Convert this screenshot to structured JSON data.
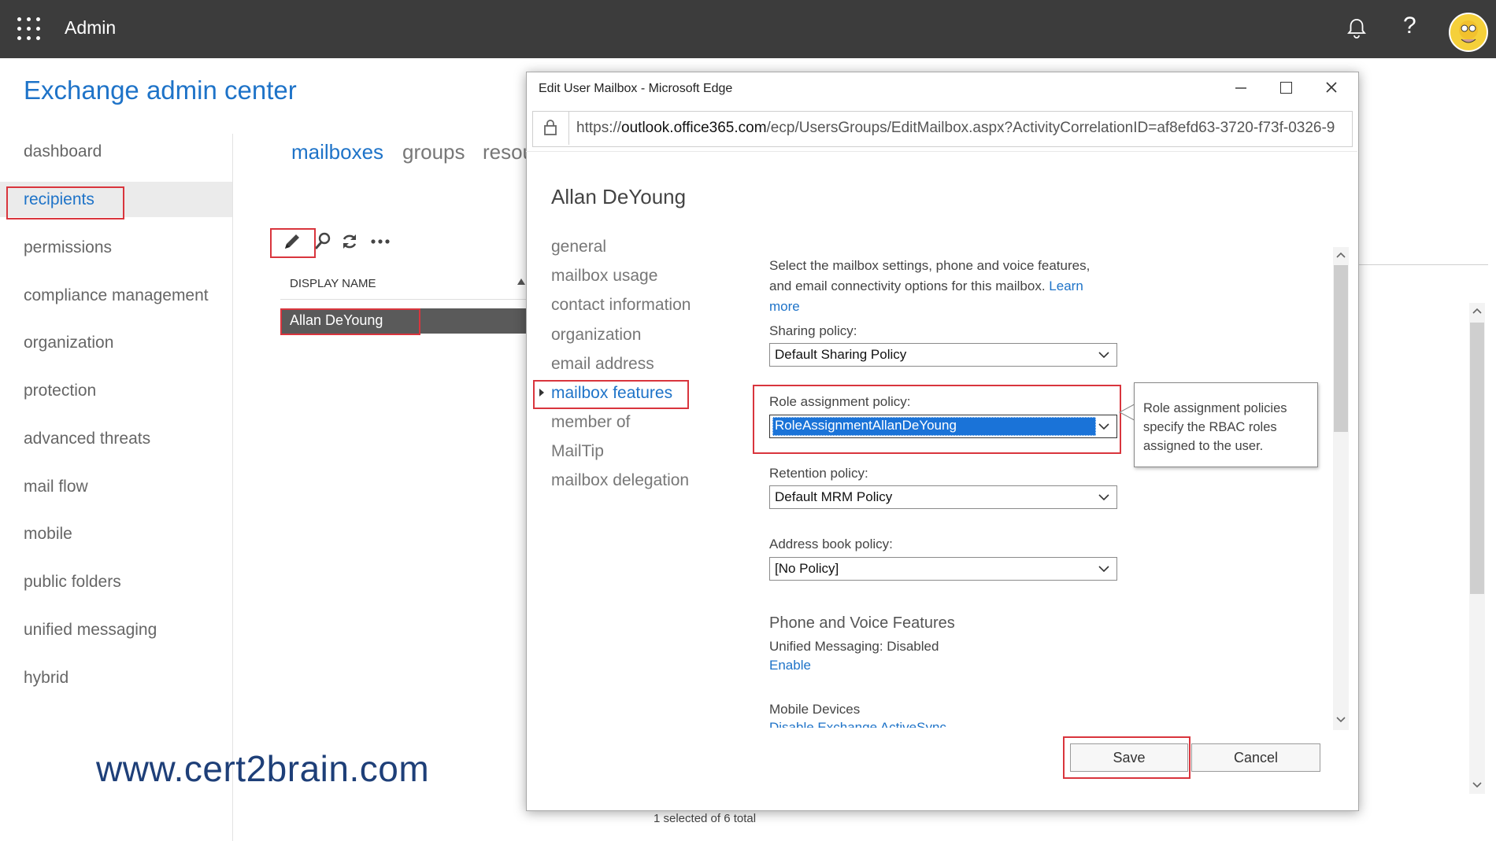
{
  "topbar": {
    "app_name": "Admin",
    "help_label": "?"
  },
  "app": {
    "title": "Exchange admin center"
  },
  "nav": {
    "items": [
      "dashboard",
      "recipients",
      "permissions",
      "compliance management",
      "organization",
      "protection",
      "advanced threats",
      "mail flow",
      "mobile",
      "public folders",
      "unified messaging",
      "hybrid"
    ],
    "selected": "recipients"
  },
  "subtabs": [
    "mailboxes",
    "groups",
    "resou"
  ],
  "list": {
    "column_header": "DISPLAY NAME",
    "rows": [
      "Allan DeYoung"
    ],
    "status": "1 selected of 6 total"
  },
  "watermark": "www.cert2brain.com",
  "dialog": {
    "window_title": "Edit User Mailbox - Microsoft Edge",
    "url_prefix": "https://",
    "url_host": "outlook.office365.com",
    "url_path": "/ecp/UsersGroups/EditMailbox.aspx?ActivityCorrelationID=af8efd63-3720-f73f-0326-9",
    "user_name": "Allan DeYoung",
    "sections": [
      "general",
      "mailbox usage",
      "contact information",
      "organization",
      "email address",
      "mailbox features",
      "member of",
      "MailTip",
      "mailbox delegation"
    ],
    "active_section": "mailbox features",
    "description": "Select the mailbox settings, phone and voice features, and email connectivity options for this mailbox.",
    "learn_more": "Learn more",
    "sharing_label": "Sharing policy:",
    "sharing_value": "Default Sharing Policy",
    "role_label": "Role assignment policy:",
    "role_value": "RoleAssignmentAllanDeYoung",
    "role_tooltip": "Role assignment policies specify the RBAC roles assigned to the user.",
    "retention_label": "Retention policy:",
    "retention_value": "Default MRM Policy",
    "addressbook_label": "Address book policy:",
    "addressbook_value": "[No Policy]",
    "phone_title": "Phone and Voice Features",
    "um_status": "Unified Messaging: Disabled",
    "um_enable": "Enable",
    "mobile_title": "Mobile Devices",
    "mobile_link": "Disable Exchange ActiveSync",
    "save_label": "Save",
    "cancel_label": "Cancel"
  },
  "colors": {
    "accent": "#1e73c8",
    "highlight_red": "#d9353d",
    "topbar": "#3c3c3c"
  }
}
